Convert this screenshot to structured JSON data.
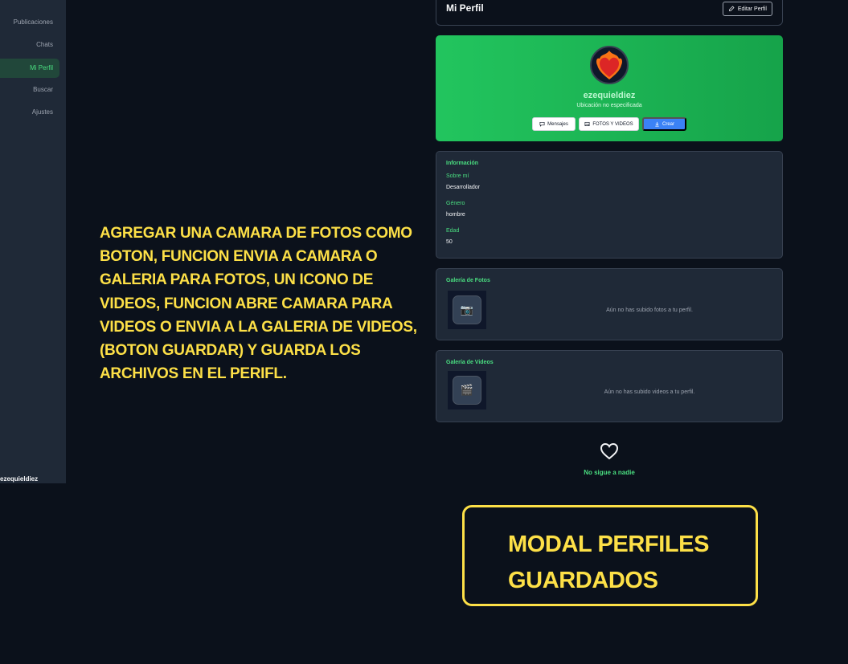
{
  "sidebar": {
    "items": [
      {
        "label": "Publicaciones",
        "active": false
      },
      {
        "label": "Chats",
        "active": false
      },
      {
        "label": "Mi Perfil",
        "active": true
      },
      {
        "label": "Buscar",
        "active": false
      },
      {
        "label": "Ajustes",
        "active": false
      }
    ],
    "user": "ezequieldiez"
  },
  "header": {
    "title": "Mi Perfil",
    "edit_label": "Editar Perfil"
  },
  "profile": {
    "username": "ezequieldiez",
    "location": "Ubicación no especificada",
    "buttons": {
      "messages": "Mensajes",
      "media": "FOTOS Y VIDEOS",
      "create": "Crear"
    }
  },
  "info": {
    "title": "Información",
    "about_label": "Sobre mí",
    "about_value": "Desarrollador",
    "gender_label": "Género",
    "gender_value": "hombre",
    "age_label": "Edad",
    "age_value": "50"
  },
  "photos": {
    "title": "Galería de Fotos",
    "empty": "Aún no has subido fotos a tu perfil.",
    "icon": "camera-icon"
  },
  "videos": {
    "title": "Galería de Videos",
    "empty": "Aún no has subido videos a tu perfil.",
    "icon": "clapperboard-icon"
  },
  "follow": {
    "text": "No sigue a nadie"
  },
  "annotations": {
    "note": "AGREGAR UNA CAMARA DE FOTOS COMO BOTON, FUNCION ENVIA A CAMARA O GALERIA PARA FOTOS, UN ICONO DE VIDEOS, FUNCION ABRE CAMARA PARA VIDEOS O ENVIA A LA GALERIA DE VIDEOS, (BOTON GUARDAR) Y GUARDA LOS ARCHIVOS EN EL PERIFL.",
    "modal": "MODAL PERFILES GUARDADOS"
  },
  "colors": {
    "accent": "#4ade80",
    "banner": "#22c55e",
    "annotation": "#fde047",
    "background": "#0b111b"
  }
}
